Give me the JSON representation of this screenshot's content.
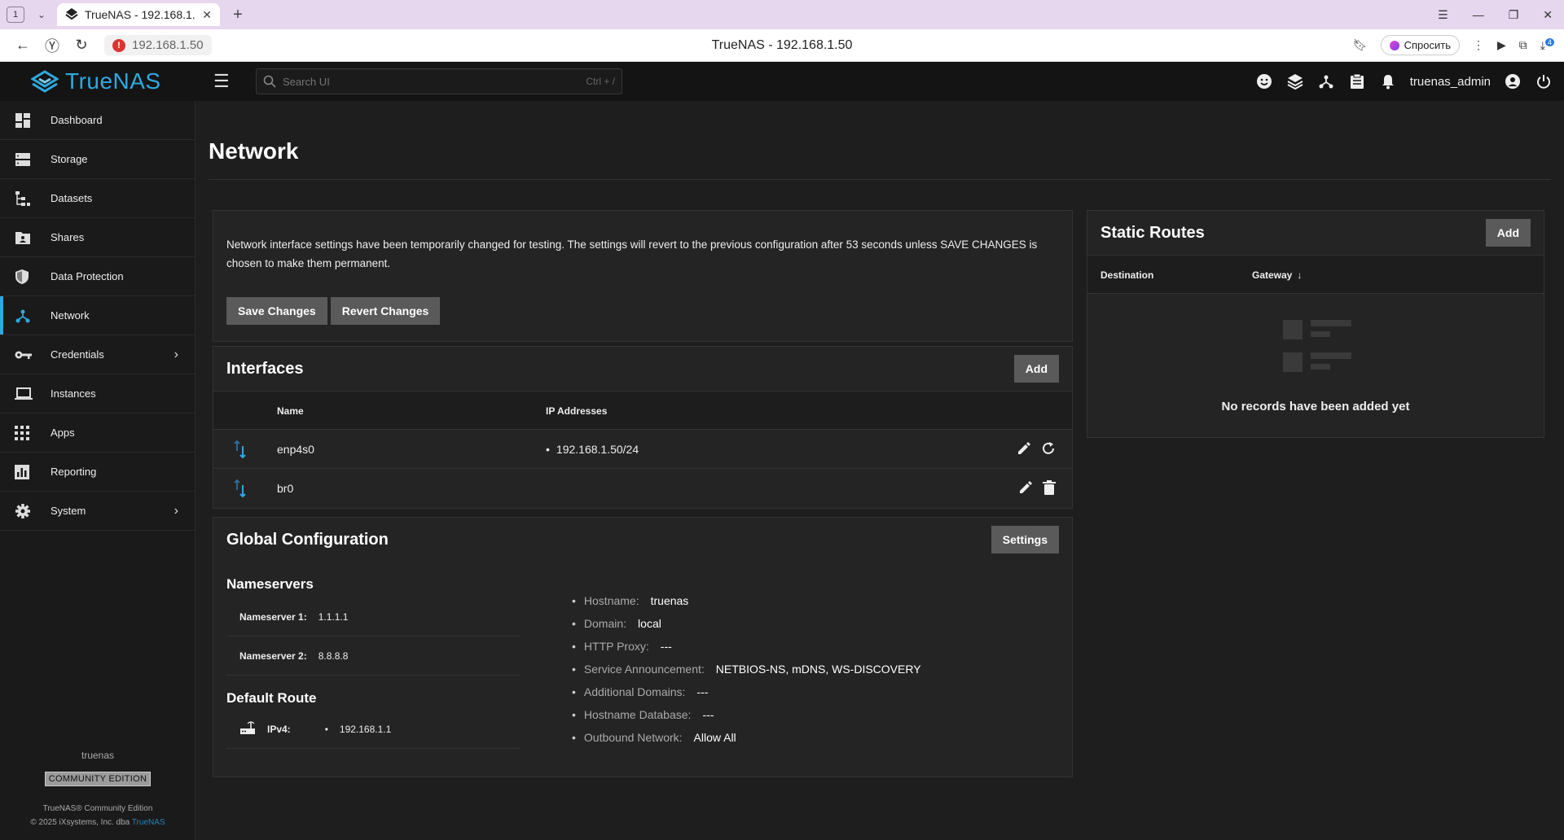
{
  "browser": {
    "tab_count": "1",
    "tab_title": "TrueNAS - 192.168.1.50",
    "url": "192.168.1.50",
    "page_title": "TrueNAS - 192.168.1.50",
    "ask_label": "Спросить",
    "download_badge": "4"
  },
  "topbar": {
    "brand": "TrueNAS",
    "search_placeholder": "Search UI",
    "search_hint": "Ctrl + /",
    "username": "truenas_admin"
  },
  "sidebar": {
    "items": [
      {
        "label": "Dashboard",
        "icon": "dashboard-icon"
      },
      {
        "label": "Storage",
        "icon": "storage-icon"
      },
      {
        "label": "Datasets",
        "icon": "datasets-icon"
      },
      {
        "label": "Shares",
        "icon": "shares-icon"
      },
      {
        "label": "Data Protection",
        "icon": "shield-icon"
      },
      {
        "label": "Network",
        "icon": "network-icon"
      },
      {
        "label": "Credentials",
        "icon": "key-icon"
      },
      {
        "label": "Instances",
        "icon": "laptop-icon"
      },
      {
        "label": "Apps",
        "icon": "apps-grid-icon"
      },
      {
        "label": "Reporting",
        "icon": "chart-icon"
      },
      {
        "label": "System",
        "icon": "gear-icon"
      }
    ],
    "active": "Network",
    "hostname": "truenas",
    "edition": "COMMUNITY EDITION",
    "copyright_line1": "TrueNAS® Community Edition",
    "copyright_line2": "© 2025 iXsystems, Inc. dba",
    "copyright_link": "TrueNAS"
  },
  "page": {
    "title": "Network"
  },
  "notice": {
    "text": "Network interface settings have been temporarily changed for testing. The settings will revert to the previous configuration after 53 seconds unless SAVE CHANGES is chosen to make them permanent.",
    "save_label": "Save Changes",
    "revert_label": "Revert Changes"
  },
  "interfaces": {
    "title": "Interfaces",
    "add_label": "Add",
    "columns": [
      "Name",
      "IP Addresses"
    ],
    "rows": [
      {
        "name": "enp4s0",
        "ip": "192.168.1.50/24"
      },
      {
        "name": "br0",
        "ip": ""
      }
    ]
  },
  "global_config": {
    "title": "Global Configuration",
    "settings_label": "Settings",
    "nameservers_title": "Nameservers",
    "nameservers": [
      {
        "label": "Nameserver 1:",
        "value": "1.1.1.1"
      },
      {
        "label": "Nameserver 2:",
        "value": "8.8.8.8"
      }
    ],
    "default_route_title": "Default Route",
    "ipv4_label": "IPv4:",
    "ipv4_value": "192.168.1.1",
    "details": [
      {
        "label": "Hostname:",
        "value": "truenas"
      },
      {
        "label": "Domain:",
        "value": "local"
      },
      {
        "label": "HTTP Proxy:",
        "value": "---"
      },
      {
        "label": "Service Announcement:",
        "value": "NETBIOS-NS, mDNS, WS-DISCOVERY"
      },
      {
        "label": "Additional Domains:",
        "value": "---"
      },
      {
        "label": "Hostname Database:",
        "value": "---"
      },
      {
        "label": "Outbound Network:",
        "value": "Allow All"
      }
    ]
  },
  "static_routes": {
    "title": "Static Routes",
    "add_label": "Add",
    "columns": [
      "Destination",
      "Gateway"
    ],
    "empty_text": "No records have been added yet"
  },
  "colors": {
    "accent": "#2fa9e0",
    "background": "#1e1e1e",
    "card": "#242424"
  }
}
